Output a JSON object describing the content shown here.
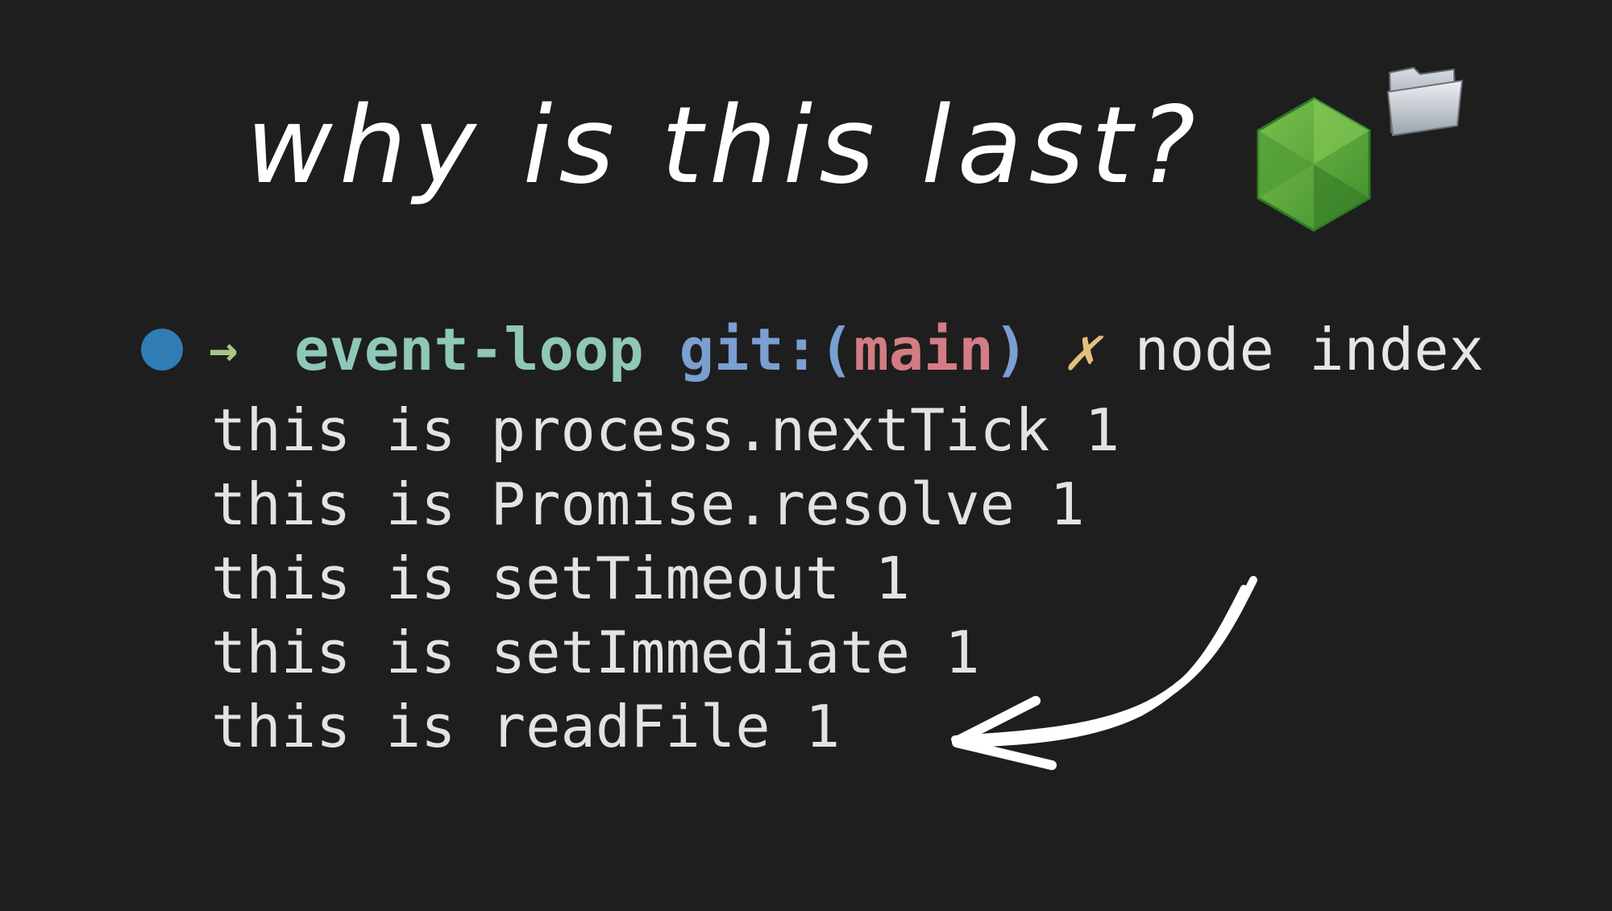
{
  "title": "why is this last?",
  "terminal": {
    "prompt": {
      "arrow": "→",
      "directory": "event-loop",
      "git_prefix": "git:(",
      "branch": "main",
      "git_suffix": ")",
      "dirty_marker": "✗",
      "command": "node index"
    },
    "output": [
      "this is process.nextTick 1",
      "this is Promise.resolve 1",
      "this is setTimeout 1",
      "this is setImmediate 1",
      "this is readFile 1"
    ]
  },
  "icons": {
    "node": "nodejs-hexagon-icon",
    "folder": "folder-icon",
    "annotation": "hand-drawn-arrow-icon"
  },
  "colors": {
    "background": "#1e1e1e",
    "node_green": "#5fae3f",
    "prompt_dot": "#2f7db4",
    "directory": "#8fc7b8",
    "git": "#7a9fd0",
    "branch": "#d47c84",
    "dirty": "#e2c07c"
  }
}
